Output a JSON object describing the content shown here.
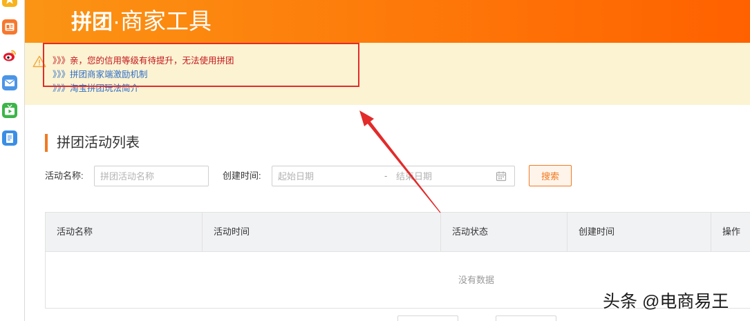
{
  "sidebar": {
    "icons": [
      {
        "name": "star-icon",
        "color": "#f8b21c"
      },
      {
        "name": "news-icon",
        "color": "#f7782e"
      },
      {
        "name": "weibo-icon",
        "color": "#e6162d"
      },
      {
        "name": "mail-icon",
        "color": "#4b95e6"
      },
      {
        "name": "tv-icon",
        "color": "#3cb54a"
      },
      {
        "name": "document-icon",
        "color": "#3a8ee6"
      }
    ]
  },
  "header": {
    "title_bold": "拼团",
    "title_rest": "·商家工具"
  },
  "notice": {
    "icon": "warning-icon",
    "prefix": "》》》",
    "warning": "亲，您的信用等级有待提升，无法使用拼团",
    "links": [
      "拼团商家端激励机制",
      "淘宝拼团玩法简介"
    ]
  },
  "section": {
    "title": "拼团活动列表"
  },
  "search": {
    "name_label": "活动名称:",
    "name_placeholder": "拼团活动名称",
    "time_label": "创建时间:",
    "start_placeholder": "起始日期",
    "separator": "-",
    "end_placeholder": "结束日期",
    "date_icon": "calendar-icon",
    "button_label": "搜索"
  },
  "table": {
    "columns": [
      "活动名称",
      "活动时间",
      "活动状态",
      "创建时间",
      "操作"
    ],
    "rows": [],
    "empty_text": "没有数据"
  },
  "watermark": "头条 @电商易王",
  "colors": {
    "header_start": "#fb9414",
    "header_end": "#ff6100",
    "notice_bg": "#fcf3d2",
    "warning_text": "#c3151b",
    "link": "#2f6fc8",
    "accent": "#f07a22",
    "annotation": "#e22b2b"
  }
}
